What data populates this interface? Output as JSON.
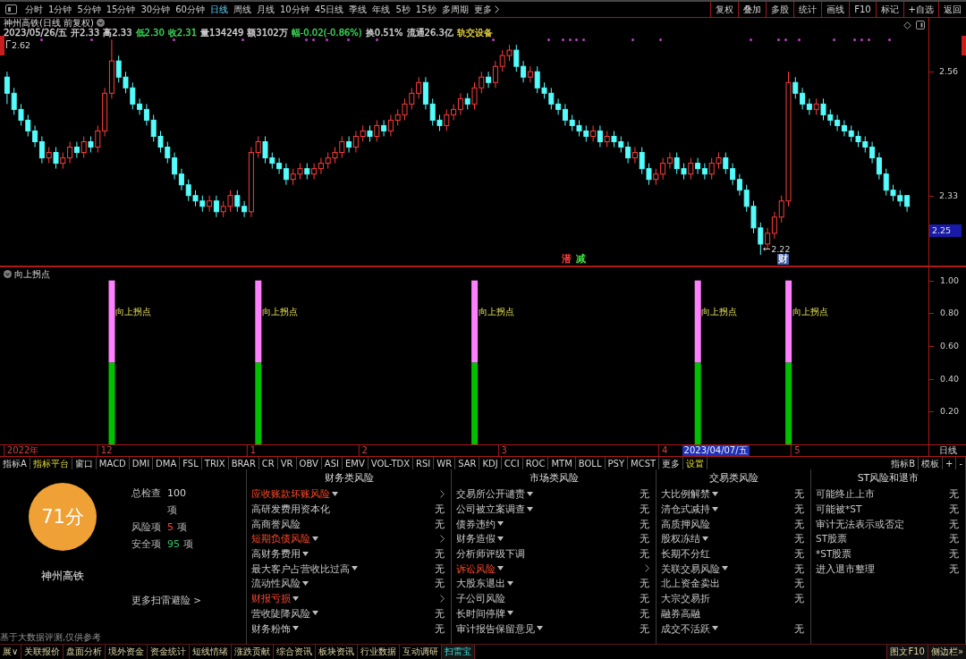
{
  "toolbar": {
    "periods": [
      {
        "label": "分时",
        "selected": false
      },
      {
        "label": "1分钟",
        "selected": false
      },
      {
        "label": "5分钟",
        "selected": false
      },
      {
        "label": "15分钟",
        "selected": false
      },
      {
        "label": "30分钟",
        "selected": false
      },
      {
        "label": "60分钟",
        "selected": false
      },
      {
        "label": "日线",
        "selected": true
      },
      {
        "label": "周线",
        "selected": false
      },
      {
        "label": "月线",
        "selected": false
      },
      {
        "label": "10分钟",
        "selected": false
      },
      {
        "label": "45日线",
        "selected": false
      },
      {
        "label": "季线",
        "selected": false
      },
      {
        "label": "年线",
        "selected": false
      },
      {
        "label": "5秒",
        "selected": false
      },
      {
        "label": "15秒",
        "selected": false
      },
      {
        "label": "多周期",
        "selected": false
      }
    ],
    "more": "更多",
    "tools": [
      "复权",
      "叠加",
      "多股",
      "统计",
      "画线",
      "F10",
      "标记",
      "+自选",
      "返回"
    ]
  },
  "quote": {
    "title": "神州高铁(日线 前复权)",
    "fields": [
      {
        "text": "2023/05/26/五",
        "color": "#d4d4d4"
      },
      {
        "text": "开2.33",
        "color": "#d4d4d4"
      },
      {
        "text": "高2.33",
        "color": "#d4d4d4"
      },
      {
        "text": "低2.30",
        "color": "#3ed85a"
      },
      {
        "text": "收2.31",
        "color": "#3ed85a"
      },
      {
        "text": "量134249",
        "color": "#d4d4d4"
      },
      {
        "text": "额3102万",
        "color": "#d4d4d4"
      },
      {
        "text": "幅-0.02(-0.86%)",
        "color": "#3ed85a"
      },
      {
        "text": "换0.51%",
        "color": "#d4d4d4"
      },
      {
        "text": "流通26.3亿",
        "color": "#d4d4d4"
      },
      {
        "text": "轨交设备",
        "color": "#e0d040"
      }
    ]
  },
  "kline": {
    "cursor_price": "2.25",
    "markers": [
      {
        "text": "潜",
        "kind": "text",
        "color": "#ff3c3c"
      },
      {
        "text": "减",
        "kind": "text",
        "color": "#3cdc3c"
      },
      {
        "text": "财",
        "kind": "badge",
        "color": "#3d5fa8"
      }
    ],
    "cursor_date": "2023/04/07/五",
    "period": "日线",
    "chart_data": [
      {
        "type": "candlestick",
        "ylim": [
          2.2,
          2.66
        ],
        "yticks": [
          2.56,
          2.33
        ],
        "annotations": [
          "2.62",
          "2.22"
        ],
        "ohlc": [
          [
            2.55,
            2.56,
            2.5,
            2.52
          ],
          [
            2.52,
            2.53,
            2.48,
            2.49
          ],
          [
            2.49,
            2.5,
            2.46,
            2.47
          ],
          [
            2.47,
            2.48,
            2.44,
            2.45
          ],
          [
            2.45,
            2.46,
            2.42,
            2.43
          ],
          [
            2.43,
            2.44,
            2.39,
            2.4
          ],
          [
            2.4,
            2.42,
            2.39,
            2.41
          ],
          [
            2.41,
            2.42,
            2.38,
            2.39
          ],
          [
            2.39,
            2.41,
            2.38,
            2.4
          ],
          [
            2.4,
            2.43,
            2.39,
            2.42
          ],
          [
            2.42,
            2.43,
            2.4,
            2.41
          ],
          [
            2.41,
            2.44,
            2.4,
            2.43
          ],
          [
            2.43,
            2.44,
            2.41,
            2.42
          ],
          [
            2.42,
            2.46,
            2.41,
            2.45
          ],
          [
            2.45,
            2.53,
            2.44,
            2.52
          ],
          [
            2.52,
            2.62,
            2.51,
            2.58
          ],
          [
            2.58,
            2.59,
            2.54,
            2.55
          ],
          [
            2.55,
            2.56,
            2.52,
            2.53
          ],
          [
            2.53,
            2.54,
            2.49,
            2.5
          ],
          [
            2.5,
            2.51,
            2.48,
            2.49
          ],
          [
            2.49,
            2.5,
            2.46,
            2.47
          ],
          [
            2.47,
            2.48,
            2.43,
            2.44
          ],
          [
            2.44,
            2.45,
            2.41,
            2.42
          ],
          [
            2.42,
            2.43,
            2.39,
            2.4
          ],
          [
            2.4,
            2.41,
            2.36,
            2.37
          ],
          [
            2.37,
            2.38,
            2.34,
            2.35
          ],
          [
            2.35,
            2.36,
            2.32,
            2.33
          ],
          [
            2.33,
            2.34,
            2.31,
            2.32
          ],
          [
            2.32,
            2.33,
            2.3,
            2.31
          ],
          [
            2.31,
            2.33,
            2.3,
            2.32
          ],
          [
            2.32,
            2.33,
            2.29,
            2.3
          ],
          [
            2.3,
            2.32,
            2.29,
            2.31
          ],
          [
            2.31,
            2.34,
            2.3,
            2.33
          ],
          [
            2.33,
            2.34,
            2.3,
            2.31
          ],
          [
            2.31,
            2.32,
            2.29,
            2.3
          ],
          [
            2.3,
            2.42,
            2.29,
            2.41
          ],
          [
            2.41,
            2.44,
            2.4,
            2.43
          ],
          [
            2.43,
            2.44,
            2.39,
            2.4
          ],
          [
            2.4,
            2.41,
            2.38,
            2.39
          ],
          [
            2.39,
            2.4,
            2.37,
            2.38
          ],
          [
            2.38,
            2.39,
            2.35,
            2.36
          ],
          [
            2.36,
            2.38,
            2.35,
            2.37
          ],
          [
            2.37,
            2.39,
            2.36,
            2.38
          ],
          [
            2.38,
            2.39,
            2.36,
            2.37
          ],
          [
            2.37,
            2.39,
            2.36,
            2.38
          ],
          [
            2.38,
            2.4,
            2.37,
            2.39
          ],
          [
            2.39,
            2.41,
            2.38,
            2.4
          ],
          [
            2.4,
            2.42,
            2.39,
            2.41
          ],
          [
            2.41,
            2.44,
            2.4,
            2.43
          ],
          [
            2.43,
            2.44,
            2.41,
            2.42
          ],
          [
            2.42,
            2.45,
            2.41,
            2.44
          ],
          [
            2.44,
            2.46,
            2.43,
            2.45
          ],
          [
            2.45,
            2.46,
            2.43,
            2.44
          ],
          [
            2.44,
            2.47,
            2.43,
            2.46
          ],
          [
            2.46,
            2.47,
            2.44,
            2.45
          ],
          [
            2.45,
            2.48,
            2.44,
            2.47
          ],
          [
            2.47,
            2.49,
            2.46,
            2.48
          ],
          [
            2.48,
            2.51,
            2.47,
            2.5
          ],
          [
            2.5,
            2.53,
            2.49,
            2.52
          ],
          [
            2.52,
            2.55,
            2.51,
            2.54
          ],
          [
            2.54,
            2.55,
            2.49,
            2.5
          ],
          [
            2.5,
            2.51,
            2.46,
            2.47
          ],
          [
            2.47,
            2.48,
            2.45,
            2.46
          ],
          [
            2.46,
            2.49,
            2.45,
            2.48
          ],
          [
            2.48,
            2.5,
            2.47,
            2.49
          ],
          [
            2.49,
            2.52,
            2.48,
            2.51
          ],
          [
            2.51,
            2.52,
            2.49,
            2.5
          ],
          [
            2.5,
            2.54,
            2.49,
            2.53
          ],
          [
            2.53,
            2.56,
            2.52,
            2.55
          ],
          [
            2.55,
            2.56,
            2.53,
            2.54
          ],
          [
            2.54,
            2.58,
            2.53,
            2.57
          ],
          [
            2.57,
            2.6,
            2.56,
            2.59
          ],
          [
            2.59,
            2.61,
            2.58,
            2.6
          ],
          [
            2.6,
            2.61,
            2.56,
            2.57
          ],
          [
            2.57,
            2.58,
            2.54,
            2.55
          ],
          [
            2.55,
            2.57,
            2.54,
            2.56
          ],
          [
            2.56,
            2.57,
            2.52,
            2.53
          ],
          [
            2.53,
            2.54,
            2.51,
            2.52
          ],
          [
            2.52,
            2.53,
            2.49,
            2.5
          ],
          [
            2.5,
            2.51,
            2.48,
            2.49
          ],
          [
            2.49,
            2.5,
            2.46,
            2.47
          ],
          [
            2.47,
            2.48,
            2.45,
            2.46
          ],
          [
            2.46,
            2.47,
            2.44,
            2.45
          ],
          [
            2.45,
            2.46,
            2.43,
            2.44
          ],
          [
            2.44,
            2.46,
            2.43,
            2.45
          ],
          [
            2.45,
            2.46,
            2.42,
            2.43
          ],
          [
            2.43,
            2.45,
            2.42,
            2.44
          ],
          [
            2.44,
            2.45,
            2.42,
            2.43
          ],
          [
            2.43,
            2.44,
            2.41,
            2.42
          ],
          [
            2.42,
            2.43,
            2.39,
            2.4
          ],
          [
            2.4,
            2.42,
            2.39,
            2.41
          ],
          [
            2.41,
            2.42,
            2.37,
            2.38
          ],
          [
            2.38,
            2.39,
            2.35,
            2.36
          ],
          [
            2.36,
            2.38,
            2.35,
            2.37
          ],
          [
            2.37,
            2.4,
            2.36,
            2.39
          ],
          [
            2.39,
            2.41,
            2.38,
            2.4
          ],
          [
            2.4,
            2.41,
            2.37,
            2.38
          ],
          [
            2.38,
            2.39,
            2.36,
            2.37
          ],
          [
            2.37,
            2.4,
            2.36,
            2.39
          ],
          [
            2.39,
            2.4,
            2.37,
            2.38
          ],
          [
            2.38,
            2.39,
            2.36,
            2.37
          ],
          [
            2.37,
            2.4,
            2.36,
            2.39
          ],
          [
            2.39,
            2.41,
            2.38,
            2.4
          ],
          [
            2.4,
            2.41,
            2.37,
            2.38
          ],
          [
            2.38,
            2.39,
            2.35,
            2.36
          ],
          [
            2.36,
            2.37,
            2.33,
            2.34
          ],
          [
            2.34,
            2.35,
            2.3,
            2.31
          ],
          [
            2.31,
            2.32,
            2.26,
            2.27
          ],
          [
            2.27,
            2.28,
            2.22,
            2.24
          ],
          [
            2.24,
            2.27,
            2.23,
            2.26
          ],
          [
            2.26,
            2.3,
            2.25,
            2.29
          ],
          [
            2.29,
            2.33,
            2.28,
            2.32
          ],
          [
            2.32,
            2.56,
            2.31,
            2.54
          ],
          [
            2.54,
            2.55,
            2.51,
            2.52
          ],
          [
            2.52,
            2.53,
            2.49,
            2.5
          ],
          [
            2.5,
            2.51,
            2.48,
            2.49
          ],
          [
            2.49,
            2.51,
            2.48,
            2.5
          ],
          [
            2.5,
            2.51,
            2.47,
            2.48
          ],
          [
            2.48,
            2.49,
            2.46,
            2.47
          ],
          [
            2.47,
            2.48,
            2.45,
            2.46
          ],
          [
            2.46,
            2.47,
            2.44,
            2.45
          ],
          [
            2.45,
            2.46,
            2.43,
            2.44
          ],
          [
            2.44,
            2.45,
            2.42,
            2.43
          ],
          [
            2.43,
            2.44,
            2.41,
            2.42
          ],
          [
            2.42,
            2.43,
            2.39,
            2.4
          ],
          [
            2.4,
            2.41,
            2.36,
            2.37
          ],
          [
            2.37,
            2.38,
            2.33,
            2.34
          ],
          [
            2.34,
            2.35,
            2.32,
            2.33
          ],
          [
            2.33,
            2.34,
            2.31,
            2.32
          ],
          [
            2.33,
            2.33,
            2.3,
            2.31
          ]
        ]
      },
      {
        "type": "bar",
        "title": "向上拐点",
        "stacked": true,
        "ylim": [
          0,
          1.08
        ],
        "yticks": [
          {
            "value": 1,
            "label": "1.00"
          },
          {
            "value": 0.8,
            "label": "0.80"
          },
          {
            "value": 0.6,
            "label": "0.60"
          },
          {
            "value": 0.4,
            "label": "0.40"
          },
          {
            "value": 0.2,
            "label": "0.20"
          }
        ],
        "annotations": [
          "向上拐点",
          "向上拐点",
          "向上拐点",
          "向上拐点",
          "向上拐点"
        ],
        "categories": [
          null,
          null,
          "2022年",
          null,
          null,
          null,
          null,
          null,
          null,
          null,
          null,
          null,
          null,
          null,
          "12",
          null,
          null,
          null,
          null,
          null,
          null,
          null,
          null,
          null,
          null,
          null,
          null,
          null,
          null,
          null,
          null,
          null,
          null,
          null,
          null,
          "1",
          null,
          null,
          null,
          null,
          null,
          null,
          null,
          null,
          null,
          null,
          null,
          null,
          null,
          null,
          null,
          "2",
          null,
          null,
          null,
          null,
          null,
          null,
          null,
          null,
          null,
          null,
          null,
          null,
          null,
          null,
          null,
          null,
          null,
          null,
          null,
          "3",
          null,
          null,
          null,
          null,
          null,
          null,
          null,
          null,
          null,
          null,
          null,
          null,
          null,
          null,
          null,
          null,
          null,
          null,
          null,
          null,
          null,
          null,
          "4",
          null,
          null,
          null,
          null,
          null,
          null,
          null,
          null,
          null,
          null,
          null,
          null,
          null,
          null,
          null,
          null,
          null,
          null,
          "5",
          null,
          null,
          null,
          null,
          null,
          null,
          null,
          null,
          null,
          null,
          null,
          null,
          null,
          null,
          null,
          null
        ],
        "series": [
          {
            "color": "#00c000",
            "values": [
              null,
              null,
              null,
              null,
              null,
              null,
              null,
              null,
              null,
              null,
              null,
              null,
              null,
              null,
              null,
              0.5,
              null,
              null,
              null,
              null,
              null,
              null,
              null,
              null,
              null,
              null,
              null,
              null,
              null,
              null,
              null,
              null,
              null,
              null,
              null,
              null,
              0.5,
              null,
              null,
              null,
              null,
              null,
              null,
              null,
              null,
              null,
              null,
              null,
              null,
              null,
              null,
              null,
              null,
              null,
              null,
              null,
              null,
              null,
              null,
              null,
              null,
              null,
              null,
              null,
              null,
              null,
              null,
              0.5,
              null,
              null,
              null,
              null,
              null,
              null,
              null,
              null,
              null,
              null,
              null,
              null,
              null,
              null,
              null,
              null,
              null,
              null,
              null,
              null,
              null,
              null,
              null,
              null,
              null,
              null,
              null,
              null,
              null,
              null,
              null,
              0.5,
              null,
              null,
              null,
              null,
              null,
              null,
              null,
              null,
              null,
              null,
              null,
              null,
              0.5,
              null,
              null,
              null,
              null,
              null,
              null,
              null,
              null,
              null,
              null,
              null,
              null,
              null,
              null,
              null,
              null,
              null
            ]
          },
          {
            "color": "#ff80ff",
            "values": [
              null,
              null,
              null,
              null,
              null,
              null,
              null,
              null,
              null,
              null,
              null,
              null,
              null,
              null,
              null,
              0.5,
              null,
              null,
              null,
              null,
              null,
              null,
              null,
              null,
              null,
              null,
              null,
              null,
              null,
              null,
              null,
              null,
              null,
              null,
              null,
              null,
              0.5,
              null,
              null,
              null,
              null,
              null,
              null,
              null,
              null,
              null,
              null,
              null,
              null,
              null,
              null,
              null,
              null,
              null,
              null,
              null,
              null,
              null,
              null,
              null,
              null,
              null,
              null,
              null,
              null,
              null,
              null,
              0.5,
              null,
              null,
              null,
              null,
              null,
              null,
              null,
              null,
              null,
              null,
              null,
              null,
              null,
              null,
              null,
              null,
              null,
              null,
              null,
              null,
              null,
              null,
              null,
              null,
              null,
              null,
              null,
              null,
              null,
              null,
              null,
              0.5,
              null,
              null,
              null,
              null,
              null,
              null,
              null,
              null,
              null,
              null,
              null,
              null,
              0.5,
              null,
              null,
              null,
              null,
              null,
              null,
              null,
              null,
              null,
              null,
              null,
              null,
              null,
              null,
              null,
              null,
              null
            ]
          }
        ]
      }
    ]
  },
  "indicator_bar": {
    "left": [
      {
        "label": "指标A",
        "highlight": false
      },
      {
        "label": "指标平台",
        "highlight": true
      },
      {
        "label": "窗口",
        "highlight": false
      },
      {
        "label": "MACD",
        "highlight": false
      },
      {
        "label": "DMI",
        "highlight": false
      },
      {
        "label": "DMA",
        "highlight": false
      },
      {
        "label": "FSL",
        "highlight": false
      },
      {
        "label": "TRIX",
        "highlight": false
      },
      {
        "label": "BRAR",
        "highlight": false
      },
      {
        "label": "CR",
        "highlight": false
      },
      {
        "label": "VR",
        "highlight": false
      },
      {
        "label": "OBV",
        "highlight": false
      },
      {
        "label": "ASI",
        "highlight": false
      },
      {
        "label": "EMV",
        "highlight": false
      },
      {
        "label": "VOL-TDX",
        "highlight": false
      },
      {
        "label": "RSI",
        "highlight": false
      },
      {
        "label": "WR",
        "highlight": false
      },
      {
        "label": "SAR",
        "highlight": false
      },
      {
        "label": "KDJ",
        "highlight": false
      },
      {
        "label": "CCI",
        "highlight": false
      },
      {
        "label": "ROC",
        "highlight": false
      },
      {
        "label": "MTM",
        "highlight": false
      },
      {
        "label": "BOLL",
        "highlight": false
      },
      {
        "label": "PSY",
        "highlight": false
      },
      {
        "label": "MCST",
        "highlight": false
      },
      {
        "label": "更多",
        "highlight": false
      },
      {
        "label": "设置",
        "highlight": true
      }
    ],
    "right": [
      "指标B",
      "模板",
      "+",
      "-"
    ]
  },
  "risk_scan": {
    "score": "71分",
    "stock": "神州高铁",
    "stats": [
      {
        "label": "总检查",
        "value": "100",
        "unit": "项",
        "color": "#d8d8d8"
      },
      {
        "label": "风险项",
        "value": "5",
        "unit": "项",
        "color": "#ff4040"
      },
      {
        "label": "安全项",
        "value": "95",
        "unit": "项",
        "color": "#33c46a"
      }
    ],
    "more_link": "更多扫雷避险 >",
    "disclaimer": "基于大数据评测,仅供参考",
    "categories": [
      {
        "title": "财务类风险",
        "items": [
          {
            "name": "应收账款坏账风险",
            "dropdown": true,
            "flagged": true
          },
          {
            "name": "高研发费用资本化",
            "dropdown": false,
            "flagged": false,
            "value": "无"
          },
          {
            "name": "高商誉风险",
            "dropdown": false,
            "flagged": false,
            "value": "无"
          },
          {
            "name": "短期负债风险",
            "dropdown": true,
            "flagged": true
          },
          {
            "name": "高财务费用",
            "dropdown": true,
            "flagged": false,
            "value": "无"
          },
          {
            "name": "最大客户占营收比过高",
            "dropdown": true,
            "flagged": false,
            "value": "无"
          },
          {
            "name": "流动性风险",
            "dropdown": true,
            "flagged": false,
            "value": "无"
          },
          {
            "name": "财报亏损",
            "dropdown": true,
            "flagged": true
          },
          {
            "name": "营收陡降风险",
            "dropdown": true,
            "flagged": false,
            "value": "无"
          },
          {
            "name": "财务粉饰",
            "dropdown": true,
            "flagged": false,
            "value": "无"
          }
        ]
      },
      {
        "title": "市场类风险",
        "items": [
          {
            "name": "交易所公开谴责",
            "dropdown": true,
            "flagged": false,
            "value": "无"
          },
          {
            "name": "公司被立案调查",
            "dropdown": true,
            "flagged": false,
            "value": "无"
          },
          {
            "name": "债券违约",
            "dropdown": true,
            "flagged": false,
            "value": "无"
          },
          {
            "name": "财务造假",
            "dropdown": true,
            "flagged": false,
            "value": "无"
          },
          {
            "name": "分析师评级下调",
            "dropdown": false,
            "flagged": false,
            "value": "无"
          },
          {
            "name": "诉讼风险",
            "dropdown": true,
            "flagged": true
          },
          {
            "name": "大股东退出",
            "dropdown": true,
            "flagged": false,
            "value": "无"
          },
          {
            "name": "子公司风险",
            "dropdown": false,
            "flagged": false,
            "value": "无"
          },
          {
            "name": "长时间停牌",
            "dropdown": true,
            "flagged": false,
            "value": "无"
          },
          {
            "name": "审计报告保留意见",
            "dropdown": true,
            "flagged": false,
            "value": "无"
          }
        ]
      },
      {
        "title": "交易类风险",
        "items": [
          {
            "name": "大比例解禁",
            "dropdown": true,
            "flagged": false,
            "value": "无"
          },
          {
            "name": "清仓式减持",
            "dropdown": true,
            "flagged": false,
            "value": "无"
          },
          {
            "name": "高质押风险",
            "dropdown": false,
            "flagged": false,
            "value": "无"
          },
          {
            "name": "股权冻结",
            "dropdown": true,
            "flagged": false,
            "value": "无"
          },
          {
            "name": "长期不分红",
            "dropdown": false,
            "flagged": false,
            "value": "无"
          },
          {
            "name": "关联交易风险",
            "dropdown": true,
            "flagged": false,
            "value": "无"
          },
          {
            "name": "北上资金卖出",
            "dropdown": false,
            "flagged": false,
            "value": "无"
          },
          {
            "name": "大宗交易折",
            "dropdown": false,
            "flagged": false,
            "value": "无"
          },
          {
            "name": "融券高融",
            "dropdown": false,
            "flagged": false
          },
          {
            "name": "成交不活跃",
            "dropdown": true,
            "flagged": false,
            "value": "无"
          }
        ]
      },
      {
        "title": "ST风险和退市",
        "items": [
          {
            "name": "可能终止上市",
            "dropdown": false,
            "flagged": false,
            "value": "无"
          },
          {
            "name": "可能被*ST",
            "dropdown": false,
            "flagged": false,
            "value": "无"
          },
          {
            "name": "审计无法表示或否定",
            "dropdown": false,
            "flagged": false,
            "value": "无"
          },
          {
            "name": "ST股票",
            "dropdown": false,
            "flagged": false,
            "value": "无"
          },
          {
            "name": "*ST股票",
            "dropdown": false,
            "flagged": false,
            "value": "无"
          },
          {
            "name": "进入退市整理",
            "dropdown": false,
            "flagged": false,
            "value": "无"
          }
        ]
      }
    ]
  },
  "bottom_tabs": {
    "tabs": [
      {
        "label": "展∨",
        "selected": false
      },
      {
        "label": "关联报价",
        "selected": false
      },
      {
        "label": "盘面分析",
        "selected": false
      },
      {
        "label": "境外资金",
        "selected": false
      },
      {
        "label": "资金统计",
        "selected": false
      },
      {
        "label": "短线情绪",
        "selected": false
      },
      {
        "label": "涨跌贡献",
        "selected": false
      },
      {
        "label": "综合资讯",
        "selected": false
      },
      {
        "label": "板块资讯",
        "selected": false
      },
      {
        "label": "行业数据",
        "selected": false
      },
      {
        "label": "互动调研",
        "selected": false
      },
      {
        "label": "扫雷宝",
        "selected": true
      }
    ],
    "right": [
      "图文F10",
      "侧边栏»"
    ]
  }
}
